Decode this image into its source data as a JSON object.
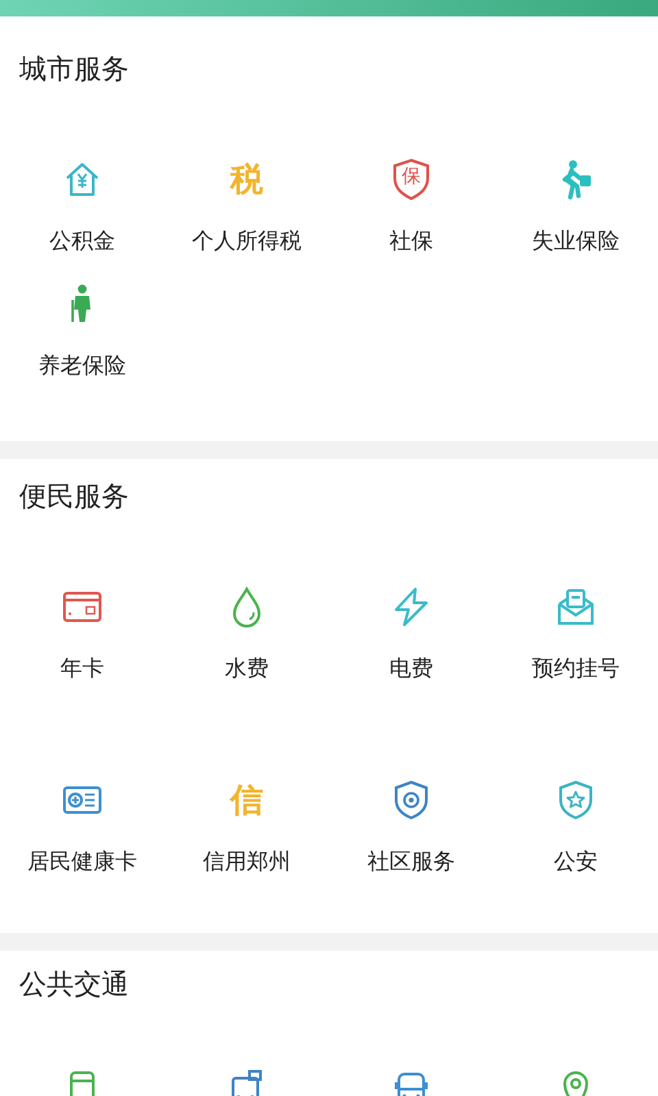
{
  "sections": [
    {
      "title": "城市服务",
      "items": [
        {
          "kind": "house",
          "label": "公积金"
        },
        {
          "kind": "glyph",
          "glyph": "税",
          "label": "个人所得税"
        },
        {
          "kind": "shield-glyph",
          "glyph": "保",
          "label": "社保"
        },
        {
          "kind": "walker",
          "label": "失业保险"
        },
        {
          "kind": "elder",
          "label": "养老保险"
        }
      ]
    },
    {
      "title": "便民服务",
      "items": [
        {
          "kind": "card",
          "label": "年卡"
        },
        {
          "kind": "drop",
          "label": "水费"
        },
        {
          "kind": "bolt",
          "label": "电费"
        },
        {
          "kind": "envelope",
          "label": "预约挂号"
        },
        {
          "kind": "health-card",
          "label": "居民健康卡"
        },
        {
          "kind": "glyph",
          "glyph": "信",
          "label": "信用郑州"
        },
        {
          "kind": "badge-shield",
          "label": "社区服务"
        },
        {
          "kind": "police-shield",
          "label": "公安"
        }
      ]
    },
    {
      "title": "公共交通",
      "items": [
        {
          "kind": "bus-front"
        },
        {
          "kind": "tram"
        },
        {
          "kind": "bus"
        },
        {
          "kind": "location"
        }
      ]
    }
  ]
}
